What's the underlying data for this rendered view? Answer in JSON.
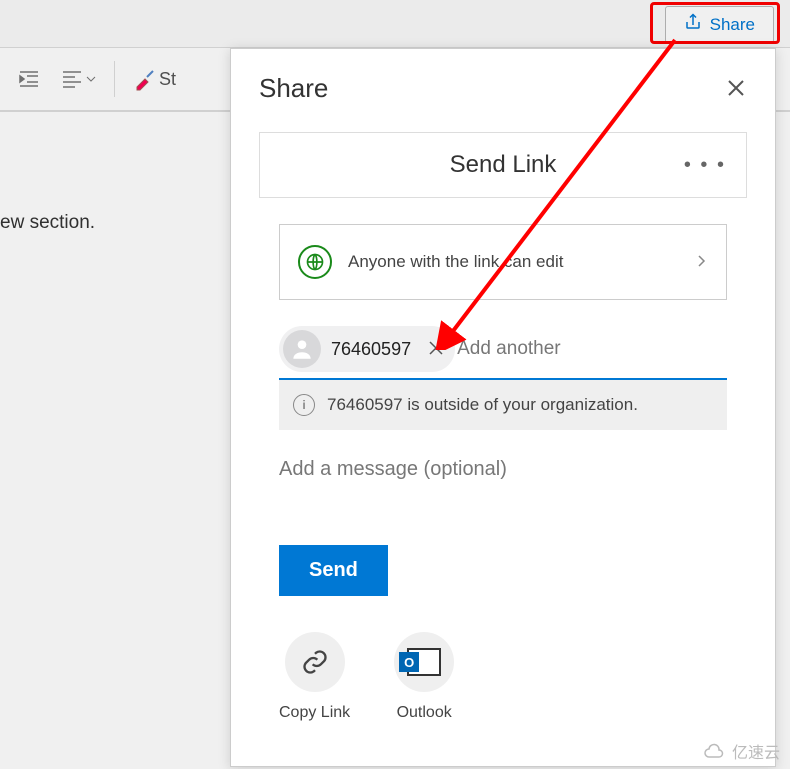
{
  "toolbar": {
    "share_label": "Share",
    "styles_label": "St"
  },
  "document": {
    "body_text": "ew section."
  },
  "share_panel": {
    "title": "Share",
    "send_link_title": "Send Link",
    "link_scope_text": "Anyone with the link can edit",
    "recipient_chip": "76460597",
    "add_placeholder": "Add another",
    "warning_text": "76460597 is outside of your organization.",
    "message_placeholder": "Add a message (optional)",
    "send_label": "Send",
    "copy_link_label": "Copy Link",
    "outlook_label": "Outlook"
  },
  "watermark": "亿速云"
}
